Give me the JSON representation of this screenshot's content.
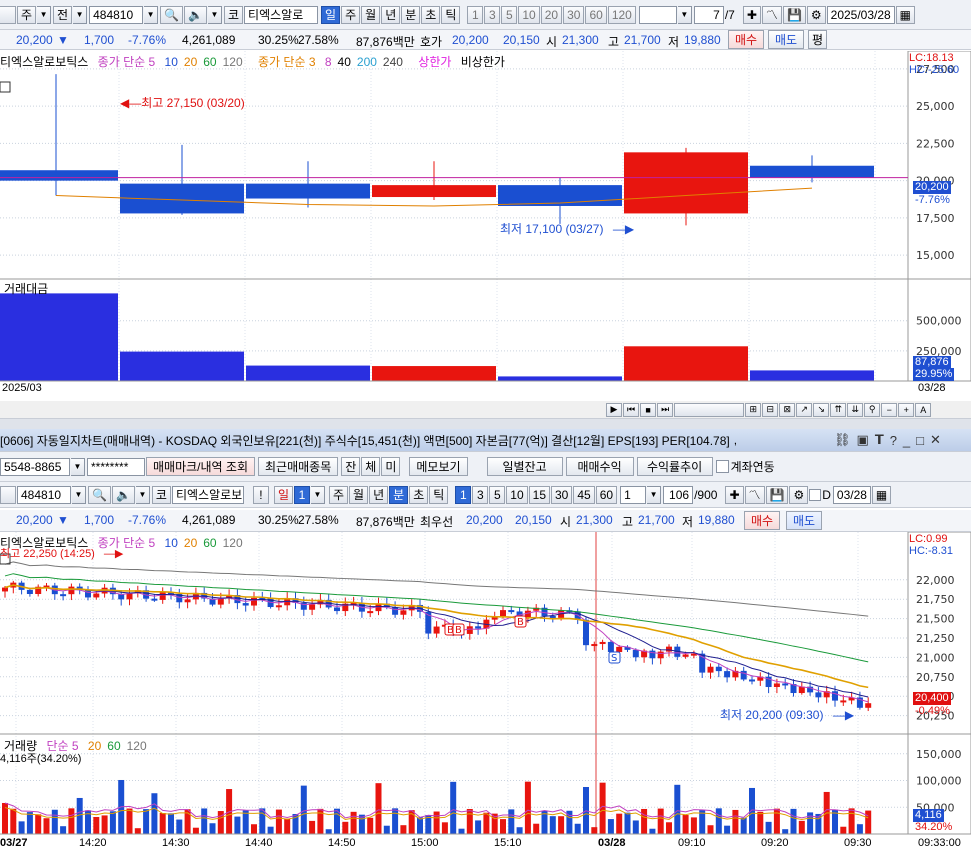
{
  "top": {
    "toolbar": {
      "mode_label": "주",
      "scope_label": "전",
      "code": "484810",
      "market_label": "코",
      "name": "티엑스알로",
      "periods": [
        "일",
        "주",
        "월",
        "년",
        "분",
        "초",
        "틱"
      ],
      "period_selected": "일",
      "ticks": [
        "1",
        "3",
        "5",
        "10",
        "20",
        "30",
        "60",
        "120"
      ],
      "page_current": "7",
      "page_total": "/7",
      "date": "2025/03/28"
    },
    "quote": {
      "price": "20,200",
      "change": "1,700",
      "rate": "-7.76%",
      "volume": "4,261,089",
      "ratio1": "30.25%",
      "ratio2": "27.58%",
      "amount": "87,876백만",
      "bid_label": "호가",
      "bid1": "20,200",
      "bid2": "20,150",
      "open_label": "시",
      "open": "21,300",
      "high_label": "고",
      "high": "21,700",
      "low_label": "저",
      "low": "19,880",
      "buy": "매수",
      "sell": "매도",
      "eval": "평"
    },
    "legend": {
      "name": "티엑스알로보틱스",
      "ma1": "종가 단순 5",
      "ma1_periods": [
        "10",
        "20",
        "60",
        "120"
      ],
      "ma2": "종가 단순 3",
      "ma2_periods": [
        "8",
        "40",
        "200",
        "240"
      ],
      "limit_up": "상한가",
      "limit_down": "비상한가"
    },
    "lc": "LC:18.13",
    "hc": "HC:-25.60",
    "annot_high": "최고 27,150 (03/20)",
    "annot_low": "최저 17,100 (03/27)",
    "price_tag": "20,200",
    "rate_tag": "-7.76%",
    "vol_title": "거래대금",
    "vol_tag": "87,876",
    "vol_rate_tag": "29.95%",
    "x_start": "2025/03",
    "x_end": "03/28"
  },
  "bottom": {
    "title": "[0606] 자동일지차트(매매내역) - KOSDAQ 외국인보유[221(천)] 주식수[15,451(천)] 액면[500] 자본금[77(억)] 결산[12월] EPS[193] PER[104.78]",
    "account": "5548-8865",
    "password": "********",
    "buttons": [
      "매매마크/내역 조회",
      "최근매매종목",
      "잔",
      "체",
      "미",
      "메모보기"
    ],
    "right_buttons": [
      "일별잔고",
      "매매수익",
      "수익률추이"
    ],
    "link_label": "계좌연동",
    "toolbar": {
      "code": "484810",
      "market_label": "코",
      "name": "티엑스알로보",
      "excl": "!",
      "period_label": "일",
      "period_num": "1",
      "periods": [
        "주",
        "월",
        "년",
        "분",
        "초",
        "틱"
      ],
      "period_selected": "분",
      "ticks": [
        "1",
        "3",
        "5",
        "10",
        "15",
        "30",
        "45",
        "60"
      ],
      "tick_selected": "1",
      "interval": "1",
      "count": "106",
      "count_total": "/900",
      "date": "03/28"
    },
    "quote": {
      "price": "20,200",
      "change": "1,700",
      "rate": "-7.76%",
      "volume": "4,261,089",
      "ratio1": "30.25%",
      "ratio2": "27.58%",
      "amount": "87,876백만",
      "bid_label": "최우선",
      "bid1": "20,200",
      "bid2": "20,150",
      "open_label": "시",
      "open": "21,300",
      "high_label": "고",
      "high": "21,700",
      "low_label": "저",
      "low": "19,880",
      "buy": "매수",
      "sell": "매도"
    },
    "legend": {
      "name": "티엑스알로보틱스",
      "ma": "종가 단순 5",
      "periods": [
        "10",
        "20",
        "60",
        "120"
      ]
    },
    "lc": "LC:0.99",
    "hc": "HC:-8.31",
    "annot_high": "최고 22,250 (14:25)",
    "annot_low": "최저 20,200 (09:30)",
    "price_tag": "20,400",
    "rate_tag": "-0.49%",
    "vol_legend": {
      "title": "거래량",
      "ma": "단순 5",
      "periods": [
        "20",
        "60",
        "120"
      ],
      "value": "4,116주(34.20%)"
    },
    "vol_tag": "4,116",
    "vol_rate_tag": "34.20%",
    "x_labels": [
      "03/27",
      "14:20",
      "14:30",
      "14:40",
      "14:50",
      "15:00",
      "15:10",
      "03/28",
      "09:10",
      "09:20",
      "09:30"
    ],
    "x_end": "09:33:00"
  },
  "chart_data": [
    {
      "type": "candlestick",
      "title": "티엑스알로보틱스 (일)",
      "y_ticks": [
        27500,
        25000,
        22500,
        20000,
        17500,
        15000
      ],
      "ylim": [
        13400,
        28700
      ],
      "candles": [
        {
          "open": 20700,
          "high": 27150,
          "low": 19000,
          "close": 20000
        },
        {
          "open": 19800,
          "high": 22400,
          "low": 17700,
          "close": 17800
        },
        {
          "open": 19800,
          "high": 21300,
          "low": 18200,
          "close": 18800
        },
        {
          "open": 18900,
          "high": 21300,
          "low": 18700,
          "close": 19700
        },
        {
          "open": 19700,
          "high": 20200,
          "low": 17100,
          "close": 18300
        },
        {
          "open": 17800,
          "high": 22200,
          "low": 17000,
          "close": 21900
        },
        {
          "open": 21000,
          "high": 21700,
          "low": 19880,
          "close": 20200
        }
      ],
      "ma_line": [
        19000,
        18700,
        18400,
        18300,
        18500,
        19000,
        19500
      ],
      "volume": {
        "y_ticks": [
          500000,
          250000
        ],
        "ylim": [
          0,
          780000
        ],
        "values": [
          727000,
          244000,
          128000,
          124000,
          38000,
          288000,
          87876
        ]
      }
    },
    {
      "type": "candlestick",
      "title": "티엑스알로보틱스 (1분)",
      "y_ticks": [
        22000,
        21750,
        21500,
        21250,
        21000,
        20750,
        20500,
        20250
      ],
      "ylim": [
        20090,
        22410
      ],
      "volume": {
        "y_ticks": [
          150000,
          100000,
          50000
        ],
        "ylim": [
          0,
          172000
        ]
      }
    }
  ]
}
